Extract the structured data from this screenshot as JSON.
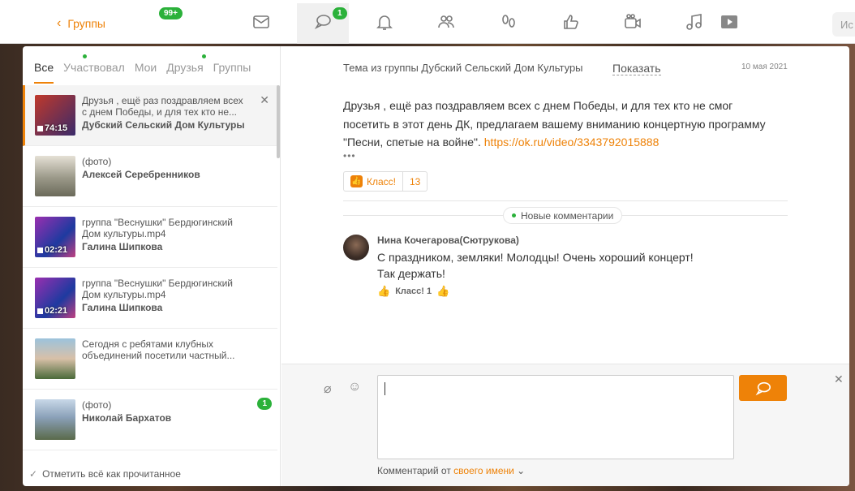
{
  "topbar": {
    "back_label": "Группы",
    "back_badge": "99+",
    "messages_badge": "1",
    "search_placeholder": "Ис",
    "icons": [
      "mail-icon",
      "chat-icon",
      "bell-icon",
      "friends-icon",
      "guests-icon",
      "like-icon",
      "video-icon",
      "music-icon",
      "play-icon"
    ]
  },
  "tabs": [
    {
      "label": "Все",
      "active": true
    },
    {
      "label": "Участвовал",
      "dot": true
    },
    {
      "label": "Мои"
    },
    {
      "label": "Друзья",
      "dot": true
    },
    {
      "label": "Группы"
    }
  ],
  "discussions": [
    {
      "snippet": "Друзья , ещё раз поздравляем всех с днем Победы, и для тех кто не...",
      "author": "Дубский Сельский Дом Культуры",
      "duration": "74:15",
      "active": true,
      "thumb_colors": [
        "#c0392b",
        "#3a2a6a"
      ]
    },
    {
      "snippet": "(фото)",
      "author": "Алексей Серебренников",
      "thumb_colors": [
        "#c9c4b8",
        "#6b6a5a"
      ]
    },
    {
      "snippet": "группа \"Веснушки\" Бердюгинский Дом культуры.mp4",
      "author": "Галина Шипкова",
      "duration": "02:21",
      "thumb_colors": [
        "#7a2f9a",
        "#1e3aa0"
      ]
    },
    {
      "snippet": "группа \"Веснушки\" Бердюгинский Дом культуры.mp4",
      "author": "Галина Шипкова",
      "duration": "02:21",
      "thumb_colors": [
        "#7a2f9a",
        "#1e3aa0"
      ]
    },
    {
      "snippet": "Сегодня с ребятами клубных объединений посетили частный...",
      "author": "",
      "thumb_colors": [
        "#8ab1c9",
        "#4a6a3a"
      ]
    },
    {
      "snippet": "(фото)",
      "author": "Николай Бархатов",
      "badge": "1",
      "thumb_colors": [
        "#8aa0b8",
        "#5a6a4a"
      ]
    }
  ],
  "mark_all_read": "Отметить всё как прочитанное",
  "topic": {
    "title": "Тема из группы Дубский Сельский Дом Культуры",
    "show_label": "Показать",
    "date": "10 мая 2021",
    "text": "Друзья , ещё раз поздравляем всех с днем Победы, и для тех кто не смог посетить в этот день ДК, предлагаем вашему вниманию концертную программу \"Песни, спетые на войне\". ",
    "link": "https://ok.ru/video/3343792015888",
    "more": "•••",
    "klass_label": "Класс!",
    "klass_count": "13"
  },
  "new_comments_label": "Новые комментарии",
  "comment": {
    "author": "Нина Кочегарова(Сютрукова)",
    "line1": "С праздником, земляки! Молодцы! Очень хороший концерт!",
    "line2": "Так держать!",
    "klass": "Класс! 1"
  },
  "composer": {
    "from_label": "Комментарий от ",
    "from_value": "своего имени"
  },
  "colors": {
    "accent": "#ee8208",
    "green": "#2bb13a"
  }
}
